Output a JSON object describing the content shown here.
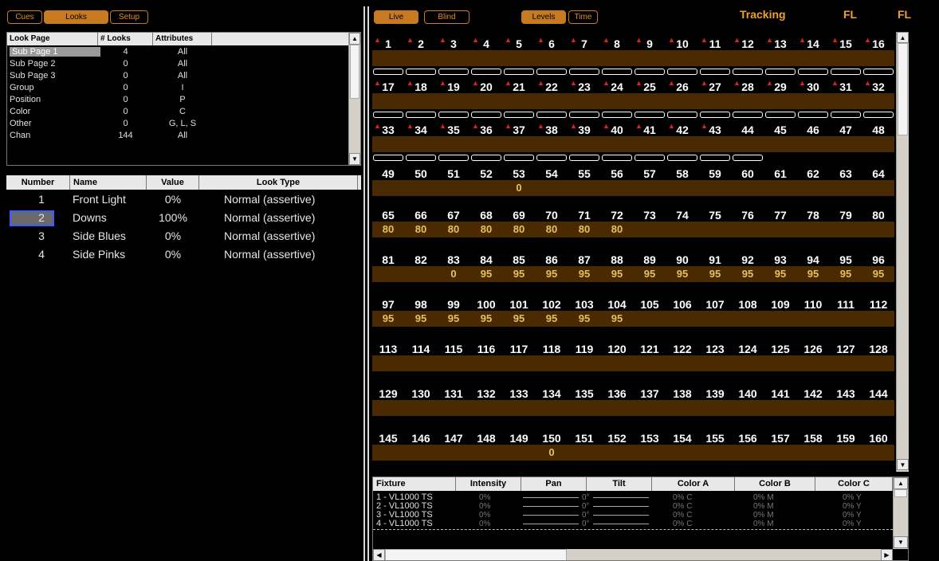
{
  "top_tabs": {
    "cues": "Cues",
    "looks": "Looks",
    "setup": "Setup"
  },
  "right_tabs": {
    "live": "Live",
    "blind": "Blind",
    "levels": "Levels",
    "time": "Time"
  },
  "status": {
    "mode": "Tracking",
    "fl1": "FL",
    "fl2": "FL"
  },
  "look_page": {
    "headers": [
      "Look Page",
      "# Looks",
      "Attributes"
    ],
    "rows": [
      {
        "name": "Sub Page 1",
        "count": "4",
        "attr": "All"
      },
      {
        "name": "Sub Page 2",
        "count": "0",
        "attr": "All"
      },
      {
        "name": "Sub Page 3",
        "count": "0",
        "attr": "All"
      },
      {
        "name": "Group",
        "count": "0",
        "attr": "I"
      },
      {
        "name": "Position",
        "count": "0",
        "attr": "P"
      },
      {
        "name": "Color",
        "count": "0",
        "attr": "C"
      },
      {
        "name": "Other",
        "count": "0",
        "attr": "G, L, S"
      },
      {
        "name": "Chan",
        "count": "144",
        "attr": "All"
      }
    ]
  },
  "looks": {
    "headers": [
      "Number",
      "Name",
      "Value",
      "Look Type"
    ],
    "rows": [
      {
        "num": "1",
        "name": "Front Light",
        "value": "0%",
        "type": "Normal (assertive)"
      },
      {
        "num": "2",
        "name": "Downs",
        "value": "100%",
        "type": "Normal (assertive)"
      },
      {
        "num": "3",
        "name": "Side Blues",
        "value": "0%",
        "type": "Normal (assertive)"
      },
      {
        "num": "4",
        "name": "Side Pinks",
        "value": "0%",
        "type": "Normal (assertive)"
      }
    ]
  },
  "channels": {
    "rows": [
      {
        "start": 1,
        "marked": 16,
        "pills": true,
        "values": []
      },
      {
        "start": 17,
        "marked": 16,
        "pills": true,
        "values": []
      },
      {
        "start": 33,
        "marked": 11,
        "pills": true,
        "pill_count": 12,
        "values": []
      },
      {
        "start": 49,
        "marked": 0,
        "values": [
          {
            "col": 4,
            "v": "0"
          }
        ]
      },
      {
        "start": 65,
        "marked": 0,
        "values": [
          {
            "col": 0,
            "v": "80"
          },
          {
            "col": 1,
            "v": "80"
          },
          {
            "col": 2,
            "v": "80"
          },
          {
            "col": 3,
            "v": "80"
          },
          {
            "col": 4,
            "v": "80"
          },
          {
            "col": 5,
            "v": "80"
          },
          {
            "col": 6,
            "v": "80"
          },
          {
            "col": 7,
            "v": "80"
          }
        ]
      },
      {
        "start": 81,
        "marked": 0,
        "values": [
          {
            "col": 2,
            "v": "0"
          },
          {
            "col": 3,
            "v": "95"
          },
          {
            "col": 4,
            "v": "95"
          },
          {
            "col": 5,
            "v": "95"
          },
          {
            "col": 6,
            "v": "95"
          },
          {
            "col": 7,
            "v": "95"
          },
          {
            "col": 8,
            "v": "95"
          },
          {
            "col": 9,
            "v": "95"
          },
          {
            "col": 10,
            "v": "95"
          },
          {
            "col": 11,
            "v": "95"
          },
          {
            "col": 12,
            "v": "95"
          },
          {
            "col": 13,
            "v": "95"
          },
          {
            "col": 14,
            "v": "95"
          },
          {
            "col": 15,
            "v": "95"
          }
        ]
      },
      {
        "start": 97,
        "marked": 0,
        "values": [
          {
            "col": 0,
            "v": "95"
          },
          {
            "col": 1,
            "v": "95"
          },
          {
            "col": 2,
            "v": "95"
          },
          {
            "col": 3,
            "v": "95"
          },
          {
            "col": 4,
            "v": "95"
          },
          {
            "col": 5,
            "v": "95"
          },
          {
            "col": 6,
            "v": "95"
          },
          {
            "col": 7,
            "v": "95"
          }
        ]
      },
      {
        "start": 113,
        "marked": 0,
        "values": []
      },
      {
        "start": 129,
        "marked": 0,
        "values": []
      },
      {
        "start": 145,
        "marked": 0,
        "values": [
          {
            "col": 5,
            "v": "0"
          }
        ]
      }
    ]
  },
  "fixture": {
    "headers": [
      "Fixture",
      "Intensity",
      "Pan",
      "Tilt",
      "Color A",
      "Color B",
      "Color C"
    ],
    "rows": [
      {
        "name": "1 - VL1000 TS",
        "intensity": "0%",
        "pan": "0°",
        "colorA": "0% C",
        "colorB": "0% M",
        "colorC": "0% Y"
      },
      {
        "name": "2 - VL1000 TS",
        "intensity": "0%",
        "pan": "0°",
        "colorA": "0% C",
        "colorB": "0% M",
        "colorC": "0% Y"
      },
      {
        "name": "3 - VL1000 TS",
        "intensity": "0%",
        "pan": "0°",
        "colorA": "0% C",
        "colorB": "0% M",
        "colorC": "0% Y"
      },
      {
        "name": "4 - VL1000 TS",
        "intensity": "0%",
        "pan": "0°",
        "colorA": "0% C",
        "colorB": "0% M",
        "colorC": "0% Y"
      }
    ]
  },
  "colors": {
    "accent": "#c87a20",
    "band": "#4a2a00",
    "value": "#e8c060",
    "marker": "#e02020"
  }
}
